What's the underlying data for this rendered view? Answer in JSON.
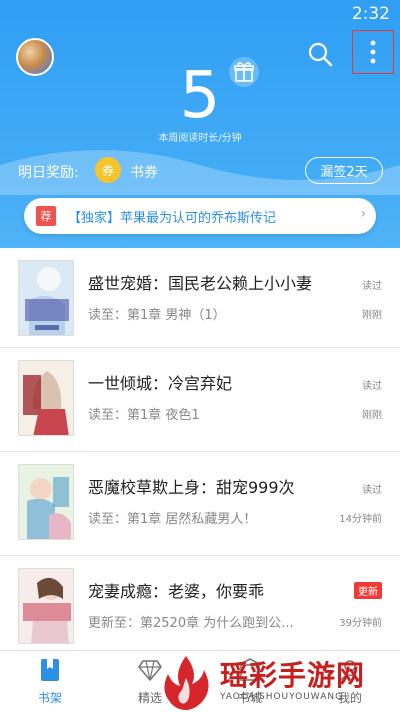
{
  "status_bar": {
    "time": "2:32"
  },
  "header": {
    "weekly_minutes": "5",
    "weekly_caption": "本周阅读时长/分钟",
    "reward_label": "明日奖励:",
    "coupon_icon_text": "券",
    "coupon_text": "书券",
    "signin_button": "漏签2天",
    "background_color": "#3aa6f5"
  },
  "banner": {
    "tag": "荐",
    "text": "【独家】苹果最为认可的乔布斯传记",
    "chevron": "›"
  },
  "books": [
    {
      "title": "盛世宠婚：国民老公赖上小小妻",
      "progress": "读至：第1章 男神（1）",
      "status": "读过",
      "time": "刚刚",
      "badge": ""
    },
    {
      "title": "一世倾城：冷宫弃妃",
      "progress": "读至：第1章 夜色1",
      "status": "读过",
      "time": "刚刚",
      "badge": ""
    },
    {
      "title": "恶魔校草欺上身：甜宠999次",
      "progress": "读至：第1章 居然私藏男人！",
      "status": "读过",
      "time": "14分钟前",
      "badge": ""
    },
    {
      "title": "宠妻成瘾：老婆，你要乖",
      "progress": "更新至：第2520章 为什么跑到公...",
      "status": "",
      "time": "39分钟前",
      "badge": "更新"
    }
  ],
  "bottom_nav": [
    {
      "label": "书架",
      "icon": "bookshelf-icon",
      "active": true
    },
    {
      "label": "精选",
      "icon": "diamond-icon",
      "active": false
    },
    {
      "label": "书城",
      "icon": "store-icon",
      "active": false
    },
    {
      "label": "我的",
      "icon": "profile-icon",
      "active": false
    }
  ],
  "watermark": {
    "main": "瑶彩手游网",
    "sub": "YAOCAISHOUYOUWANG"
  },
  "colors": {
    "accent": "#2b8fe6",
    "badge_red": "#ef3b36",
    "coupon_yellow": "#f7c42b"
  }
}
